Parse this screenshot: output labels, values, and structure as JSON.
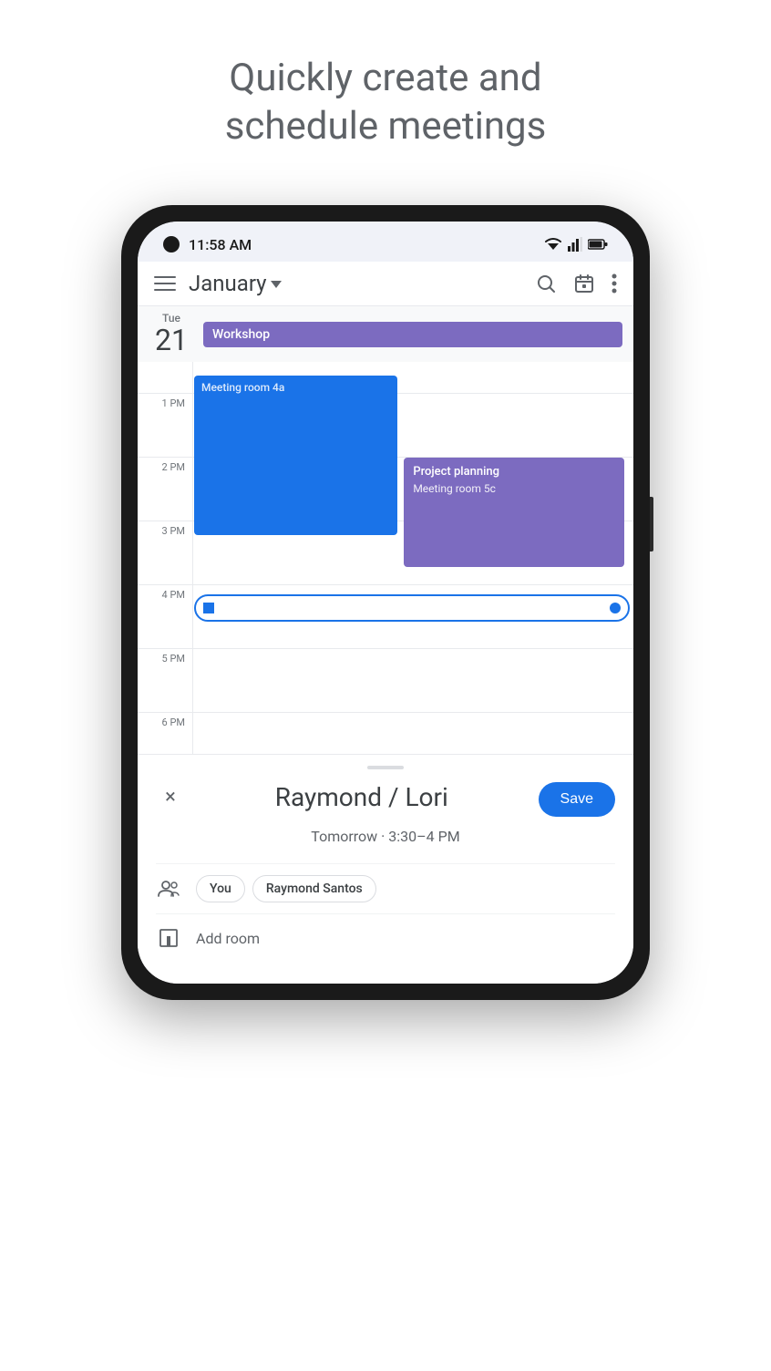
{
  "hero": {
    "line1": "Quickly create and",
    "line2": "schedule meetings"
  },
  "statusBar": {
    "time": "11:58 AM"
  },
  "header": {
    "month": "January",
    "dropdown_arrow": "▾"
  },
  "calendar": {
    "day_name": "Tue",
    "day_num": "21",
    "all_day_event": "Workshop",
    "times": [
      "1 PM",
      "2 PM",
      "3 PM",
      "4 PM",
      "5 PM",
      "6 PM"
    ],
    "event_blue_top": "Meeting room 4a",
    "event_purple_title": "Project planning",
    "event_purple_room": "Meeting room 5c"
  },
  "bottomSheet": {
    "event_title": "Raymond / Lori",
    "datetime": "Tomorrow · 3:30–4 PM",
    "save_label": "Save",
    "close_label": "×",
    "attendees": [
      "You",
      "Raymond Santos"
    ],
    "add_room_label": "Add room"
  }
}
